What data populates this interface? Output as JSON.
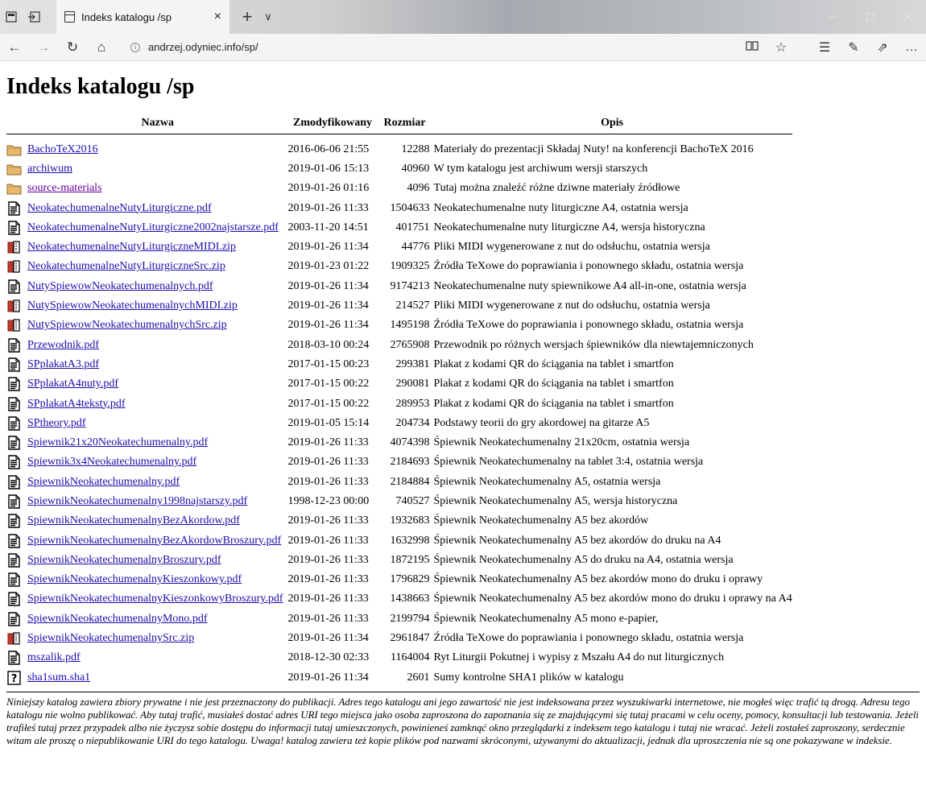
{
  "browser": {
    "tab_title": "Indeks katalogu /sp",
    "url": "andrzej.odyniec.info/sp/",
    "icons": {
      "back": "←",
      "forward": "→",
      "refresh": "↻",
      "home": "⌂",
      "reading": "📖",
      "favorite": "☆",
      "favorites_list": "☰",
      "pen": "✎",
      "share": "⇗",
      "more": "…",
      "close_tab": "×",
      "new_tab": "+",
      "tab_list": "∨"
    }
  },
  "page": {
    "title": "Indeks katalogu /sp",
    "columns": {
      "name": "Nazwa",
      "modified": "Zmodyfikowany",
      "size": "Rozmiar",
      "description": "Opis"
    },
    "rows": [
      {
        "icon": "folder",
        "name": "BachoTeX2016",
        "modified": "2016-06-06 21:55",
        "size": "12288",
        "desc": "Materiały do prezentacji Składaj Nuty! na konferencji BachoTeX 2016",
        "visited": false
      },
      {
        "icon": "folder",
        "name": "archiwum",
        "modified": "2019-01-06 15:13",
        "size": "40960",
        "desc": "W tym katalogu jest archiwum wersji starszych",
        "visited": false
      },
      {
        "icon": "folder",
        "name": "source-materials",
        "modified": "2019-01-26 01:16",
        "size": "4096",
        "desc": "Tutaj można znaleźć różne dziwne materiały źródłowe",
        "visited": true
      },
      {
        "icon": "document",
        "name": "NeokatechumenalneNutyLiturgiczne.pdf",
        "modified": "2019-01-26 11:33",
        "size": "1504633",
        "desc": "Neokatechumenalne nuty liturgiczne A4, ostatnia wersja",
        "visited": false
      },
      {
        "icon": "document",
        "name": "NeokatechumenalneNutyLiturgiczne2002najstarsze.pdf",
        "modified": "2003-11-20 14:51",
        "size": "401751",
        "desc": "Neokatechumenalne nuty liturgiczne A4, wersja historyczna",
        "visited": false
      },
      {
        "icon": "archive",
        "name": "NeokatechumenalneNutyLiturgiczneMIDI.zip",
        "modified": "2019-01-26 11:34",
        "size": "44776",
        "desc": "Pliki MIDI wygenerowane z nut do odsłuchu, ostatnia wersja",
        "visited": false
      },
      {
        "icon": "archive",
        "name": "NeokatechumenalneNutyLiturgiczneSrc.zip",
        "modified": "2019-01-23 01:22",
        "size": "1909325",
        "desc": "Źródła TeXowe do poprawiania i ponownego składu, ostatnia wersja",
        "visited": false
      },
      {
        "icon": "document",
        "name": "NutySpiewowNeokatechumenalnych.pdf",
        "modified": "2019-01-26 11:34",
        "size": "9174213",
        "desc": "Neokatechumenalne nuty spiewnikowe A4 all-in-one, ostatnia wersja",
        "visited": false
      },
      {
        "icon": "archive",
        "name": "NutySpiewowNeokatechumenalnychMIDI.zip",
        "modified": "2019-01-26 11:34",
        "size": "214527",
        "desc": "Pliki MIDI wygenerowane z nut do odsłuchu, ostatnia wersja",
        "visited": false
      },
      {
        "icon": "archive",
        "name": "NutySpiewowNeokatechumenalnychSrc.zip",
        "modified": "2019-01-26 11:34",
        "size": "1495198",
        "desc": "Źródła TeXowe do poprawiania i ponownego składu, ostatnia wersja",
        "visited": false
      },
      {
        "icon": "document",
        "name": "Przewodnik.pdf",
        "modified": "2018-03-10 00:24",
        "size": "2765908",
        "desc": "Przewodnik po różnych wersjach śpiewników dla niewtajemniczonych",
        "visited": false
      },
      {
        "icon": "document",
        "name": "SPplakatA3.pdf",
        "modified": "2017-01-15 00:23",
        "size": "299381",
        "desc": "Plakat z kodami QR do ściągania na tablet i smartfon",
        "visited": false
      },
      {
        "icon": "document",
        "name": "SPplakatA4nuty.pdf",
        "modified": "2017-01-15 00:22",
        "size": "290081",
        "desc": "Plakat z kodami QR do ściągania na tablet i smartfon",
        "visited": false
      },
      {
        "icon": "document",
        "name": "SPplakatA4teksty.pdf",
        "modified": "2017-01-15 00:22",
        "size": "289953",
        "desc": "Plakat z kodami QR do ściągania na tablet i smartfon",
        "visited": false
      },
      {
        "icon": "document",
        "name": "SPtheory.pdf",
        "modified": "2019-01-05 15:14",
        "size": "204734",
        "desc": "Podstawy teorii do gry akordowej na gitarze A5",
        "visited": false
      },
      {
        "icon": "document",
        "name": "Spiewnik21x20Neokatechumenalny.pdf",
        "modified": "2019-01-26 11:33",
        "size": "4074398",
        "desc": "Śpiewnik Neokatechumenalny 21x20cm, ostatnia wersja",
        "visited": false
      },
      {
        "icon": "document",
        "name": "Spiewnik3x4Neokatechumenalny.pdf",
        "modified": "2019-01-26 11:33",
        "size": "2184693",
        "desc": "Śpiewnik Neokatechumenalny na tablet 3:4, ostatnia wersja",
        "visited": false
      },
      {
        "icon": "document",
        "name": "SpiewnikNeokatechumenalny.pdf",
        "modified": "2019-01-26 11:33",
        "size": "2184884",
        "desc": "Śpiewnik Neokatechumenalny A5, ostatnia wersja",
        "visited": false
      },
      {
        "icon": "document",
        "name": "SpiewnikNeokatechumenalny1998najstarszy.pdf",
        "modified": "1998-12-23 00:00",
        "size": "740527",
        "desc": "Śpiewnik Neokatechumenalny A5, wersja historyczna",
        "visited": false
      },
      {
        "icon": "document",
        "name": "SpiewnikNeokatechumenalnyBezAkordow.pdf",
        "modified": "2019-01-26 11:33",
        "size": "1932683",
        "desc": "Śpiewnik Neokatechumenalny A5 bez akordów",
        "visited": false
      },
      {
        "icon": "document",
        "name": "SpiewnikNeokatechumenalnyBezAkordowBroszury.pdf",
        "modified": "2019-01-26 11:33",
        "size": "1632998",
        "desc": "Śpiewnik Neokatechumenalny A5 bez akordów do druku na A4",
        "visited": false
      },
      {
        "icon": "document",
        "name": "SpiewnikNeokatechumenalnyBroszury.pdf",
        "modified": "2019-01-26 11:33",
        "size": "1872195",
        "desc": "Śpiewnik Neokatechumenalny A5 do druku na A4, ostatnia wersja",
        "visited": false
      },
      {
        "icon": "document",
        "name": "SpiewnikNeokatechumenalnyKieszonkowy.pdf",
        "modified": "2019-01-26 11:33",
        "size": "1796829",
        "desc": "Śpiewnik Neokatechumenalny A5 bez akordów mono do druku i oprawy",
        "visited": false
      },
      {
        "icon": "document",
        "name": "SpiewnikNeokatechumenalnyKieszonkowyBroszury.pdf",
        "modified": "2019-01-26 11:33",
        "size": "1438663",
        "desc": "Śpiewnik Neokatechumenalny A5 bez akordów mono do druku i oprawy na A4",
        "visited": false
      },
      {
        "icon": "document",
        "name": "SpiewnikNeokatechumenalnyMono.pdf",
        "modified": "2019-01-26 11:33",
        "size": "2199794",
        "desc": "Śpiewnik Neokatechumenalny A5 mono e-papier,",
        "visited": false
      },
      {
        "icon": "archive",
        "name": "SpiewnikNeokatechumenalnySrc.zip",
        "modified": "2019-01-26 11:34",
        "size": "2961847",
        "desc": "Źródła TeXowe do poprawiania i ponownego składu, ostatnia wersja",
        "visited": false
      },
      {
        "icon": "document",
        "name": "mszalik.pdf",
        "modified": "2018-12-30 02:33",
        "size": "1164004",
        "desc": "Ryt Liturgii Pokutnej i wypisy z Mszału A4 do nut liturgicznych",
        "visited": false
      },
      {
        "icon": "unknown",
        "name": "sha1sum.sha1",
        "modified": "2019-01-26 11:34",
        "size": "2601",
        "desc": "Sumy kontrolne SHA1 plików w katalogu",
        "visited": false
      }
    ],
    "notice": "Niniejszy katalog zawiera zbiory prywatne i nie jest przeznaczony do publikacji. Adres tego katalogu ani jego zawartość nie jest indeksowana przez wyszukiwarki internetowe, nie mogłeś więc trafić tą drogą. Adresu tego katalogu nie wolno publikować. Aby tutaj trafić, musiałeś dostać adres URI tego miejsca jako osoba zaproszona do zapoznania się ze znajdującymi się tutaj pracami w celu oceny, pomocy, konsultacji lub testowania. Jeżeli trafiłeś tutaj przez przypadek albo nie życzysz sobie dostępu do informacji tutaj umieszczonych, powinieneś zamknąć okno przeglądarki z indeksem tego katalogu i tutaj nie wracać. Jeżeli zostałeś zaproszony, serdecznie witam ale proszę o niepublikowanie URI do tego katalogu. Uwaga! katalog zawiera też kopie plików pod nazwami skróconymi, używanymi do aktualizacji, jednak dla uproszczenia nie są one pokazywane w indeksie."
  },
  "colors": {
    "link": "#1a0dab",
    "visited_link": "#660099",
    "folder": "#e8b86b"
  }
}
